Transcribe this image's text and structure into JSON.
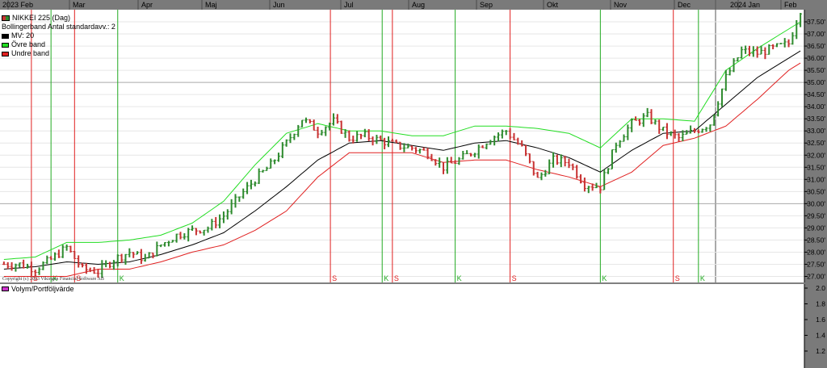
{
  "colors": {
    "background": "#ffffff",
    "axis_strip": "#7a7a7a",
    "up_bar": "#2e8b2e",
    "down_bar": "#c83232",
    "ma_line": "#000000",
    "upper_band": "#22dd22",
    "lower_band": "#e02020",
    "sell_line": "#e02020",
    "buy_line": "#22aa22",
    "volume_swatch": "#cc33cc",
    "grid": "#d0d0d0"
  },
  "legend": {
    "series_label": "NIKKEI 225 (Dag)",
    "indicator_label": "Bollingerband  Antal standardavv.: 2",
    "ma_label": "MV: 20",
    "upper_label": "Övre band",
    "lower_label": "Undre band"
  },
  "copyright": "Copyright (c) 2023 Vikingen Financial Software AB",
  "volume_panel": {
    "label": "Volym/Portföljvärde",
    "ticks": [
      "2.0",
      "1.8",
      "1.6",
      "1.4",
      "1.2"
    ]
  },
  "chart_data": {
    "type": "candlestick",
    "title": "NIKKEI 225 (Dag)",
    "time_axis_labels": [
      "2023 Feb",
      "Mar",
      "Apr",
      "Maj",
      "Jun",
      "Jul",
      "Aug",
      "Sep",
      "Okt",
      "Nov",
      "Dec",
      "2024 Jan",
      "Feb"
    ],
    "y_ticks": [
      "37.50'",
      "37.00'",
      "36.50'",
      "36.00'",
      "35.50'",
      "35.00'",
      "34.50'",
      "34.00'",
      "33.50'",
      "33.00'",
      "32.50'",
      "32.00'",
      "31.50'",
      "31.00'",
      "30.50'",
      "30.00'",
      "29.50'",
      "29.00'",
      "28.50'",
      "28.00'",
      "27.50'",
      "27.00'"
    ],
    "ylim_thousands": [
      26.75,
      38.0
    ],
    "signals": [
      {
        "type": "S",
        "week": 3.5
      },
      {
        "type": "K",
        "week": 6.0
      },
      {
        "type": "S",
        "week": 9.0
      },
      {
        "type": "K",
        "week": 14.5
      },
      {
        "type": "S",
        "week": 41.6
      },
      {
        "type": "K",
        "week": 48.2
      },
      {
        "type": "S",
        "week": 49.5
      },
      {
        "type": "K",
        "week": 57.5
      },
      {
        "type": "S",
        "week": 64.5
      },
      {
        "type": "K",
        "week": 76.0
      },
      {
        "type": "S",
        "week": 85.3
      },
      {
        "type": "K",
        "week": 88.5
      }
    ],
    "series": [
      {
        "name": "NIKKEI 225 (Dag)",
        "kind": "close",
        "weeks": [
          0,
          2,
          4,
          6,
          8,
          10,
          12,
          14,
          16,
          18,
          20,
          22,
          24,
          26,
          28,
          30,
          32,
          34,
          36,
          38,
          40,
          42,
          44,
          46,
          48,
          50,
          52,
          54,
          56,
          58,
          60,
          62,
          64,
          66,
          68,
          70,
          72,
          74,
          76,
          78,
          80,
          82,
          84,
          86,
          88,
          90,
          92,
          94,
          96,
          98,
          100,
          101.5
        ],
        "values": [
          27.5,
          27.5,
          27.3,
          27.7,
          28.2,
          27.3,
          27.2,
          27.7,
          28.0,
          27.7,
          28.3,
          28.7,
          28.9,
          29.0,
          29.5,
          30.3,
          31.0,
          31.6,
          32.5,
          33.5,
          33.0,
          33.4,
          32.7,
          32.8,
          32.6,
          32.4,
          32.3,
          32.1,
          31.5,
          31.8,
          32.2,
          32.7,
          33.0,
          32.3,
          31.0,
          31.8,
          31.7,
          30.8,
          30.7,
          32.5,
          33.3,
          33.6,
          33.0,
          32.7,
          33.0,
          33.3,
          35.2,
          36.3,
          36.2,
          36.4,
          36.6,
          38.0
        ]
      },
      {
        "name": "MV: 20",
        "kind": "ma",
        "weeks": [
          0,
          4,
          8,
          12,
          16,
          20,
          24,
          28,
          32,
          36,
          40,
          44,
          48,
          52,
          56,
          60,
          64,
          68,
          72,
          76,
          80,
          84,
          88,
          92,
          96,
          100,
          101.5
        ],
        "values": [
          27.3,
          27.4,
          27.6,
          27.5,
          27.6,
          27.9,
          28.3,
          28.8,
          29.7,
          30.7,
          31.8,
          32.5,
          32.6,
          32.4,
          32.2,
          32.5,
          32.6,
          32.3,
          31.9,
          31.3,
          32.2,
          32.9,
          33.0,
          34.1,
          35.2,
          36.0,
          36.3
        ]
      },
      {
        "name": "Övre band",
        "kind": "upper",
        "weeks": [
          0,
          4,
          8,
          12,
          16,
          20,
          24,
          28,
          32,
          36,
          40,
          44,
          48,
          52,
          56,
          60,
          64,
          68,
          72,
          76,
          80,
          84,
          88,
          92,
          96,
          100,
          101.5
        ],
        "values": [
          27.7,
          27.8,
          28.4,
          28.4,
          28.5,
          28.7,
          29.2,
          30.1,
          31.6,
          32.9,
          33.3,
          33.0,
          33.0,
          32.8,
          32.8,
          33.2,
          33.2,
          33.1,
          32.9,
          32.3,
          33.5,
          33.5,
          33.4,
          35.5,
          36.4,
          37.2,
          37.5
        ]
      },
      {
        "name": "Undre band",
        "kind": "lower",
        "weeks": [
          0,
          4,
          8,
          12,
          16,
          20,
          24,
          28,
          32,
          36,
          40,
          44,
          48,
          52,
          56,
          60,
          64,
          68,
          72,
          76,
          80,
          84,
          88,
          92,
          96,
          100,
          101.5
        ],
        "values": [
          27.0,
          27.0,
          27.0,
          27.3,
          27.3,
          27.6,
          28.0,
          28.3,
          28.9,
          29.7,
          31.1,
          32.1,
          32.1,
          32.1,
          31.7,
          31.8,
          31.8,
          31.4,
          31.1,
          30.7,
          31.3,
          32.4,
          32.7,
          33.2,
          34.3,
          35.5,
          35.8
        ]
      }
    ]
  }
}
